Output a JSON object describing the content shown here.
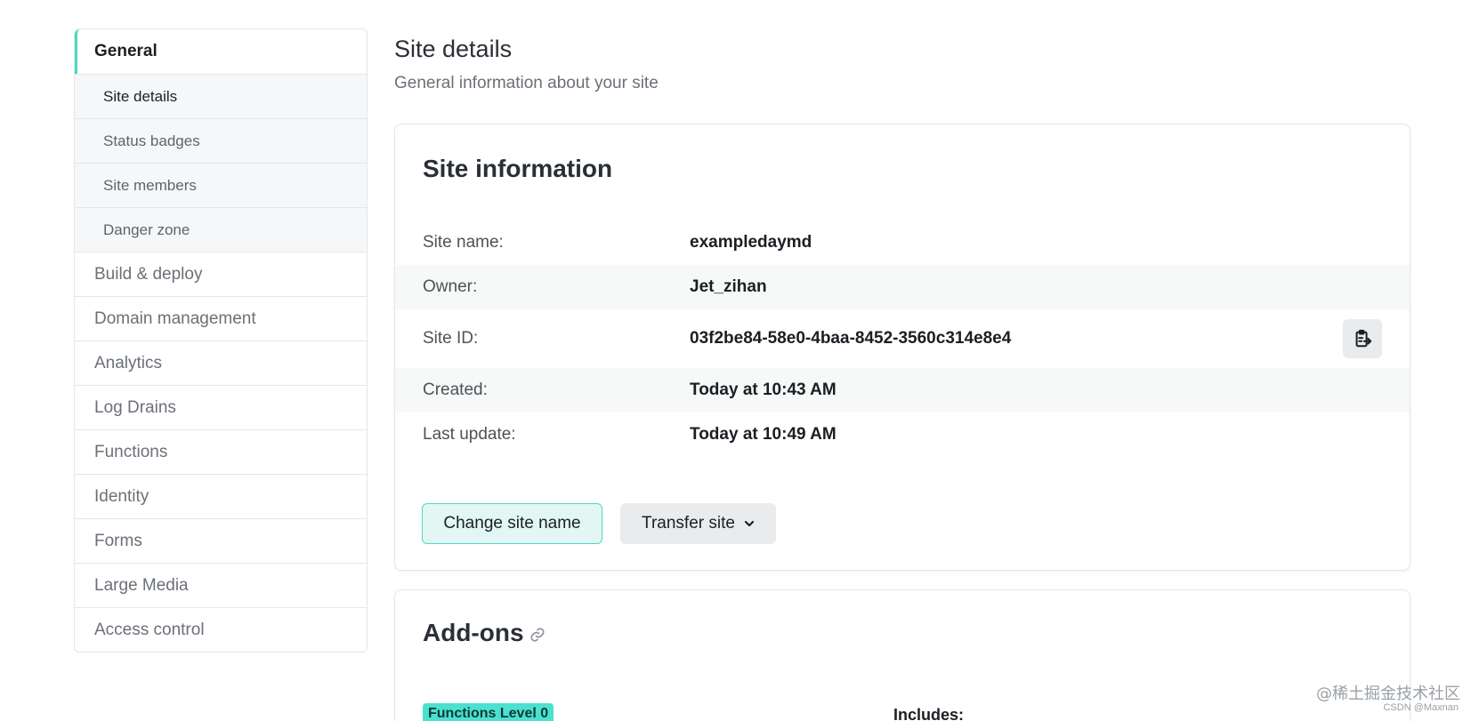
{
  "sidebar": {
    "items": [
      {
        "label": "General"
      },
      {
        "label": "Build & deploy"
      },
      {
        "label": "Domain management"
      },
      {
        "label": "Analytics"
      },
      {
        "label": "Log Drains"
      },
      {
        "label": "Functions"
      },
      {
        "label": "Identity"
      },
      {
        "label": "Forms"
      },
      {
        "label": "Large Media"
      },
      {
        "label": "Access control"
      }
    ],
    "subitems": [
      {
        "label": "Site details"
      },
      {
        "label": "Status badges"
      },
      {
        "label": "Site members"
      },
      {
        "label": "Danger zone"
      }
    ]
  },
  "header": {
    "title": "Site details",
    "subtitle": "General information about your site"
  },
  "site_info": {
    "title": "Site information",
    "rows": [
      {
        "label": "Site name:",
        "value": "exampledaymd"
      },
      {
        "label": "Owner:",
        "value": "Jet_zihan"
      },
      {
        "label": "Site ID:",
        "value": "03f2be84-58e0-4baa-8452-3560c314e8e4"
      },
      {
        "label": "Created:",
        "value": "Today at 10:43 AM"
      },
      {
        "label": "Last update:",
        "value": "Today at 10:49 AM"
      }
    ],
    "change_name_label": "Change site name",
    "transfer_label": "Transfer site"
  },
  "addons": {
    "title": "Add-ons",
    "badge": "Functions Level 0",
    "includes_label": "Includes:"
  },
  "watermark": {
    "main": "@稀土掘金技术社区",
    "small": "CSDN @Maxnan"
  },
  "colors": {
    "accent": "#4cd8c6",
    "badge": "#4ce0d0"
  }
}
